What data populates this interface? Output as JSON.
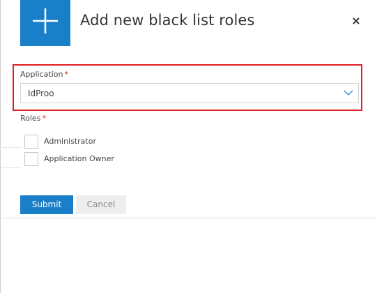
{
  "dialog": {
    "title": "Add new black list roles",
    "close_icon": "close-icon",
    "header_icon": "plus-icon",
    "accent_color": "#1a7fc9",
    "highlight_color": "#e01e24"
  },
  "form": {
    "application": {
      "label": "Application",
      "required_marker": "*",
      "selected_value": "IdProo",
      "chevron_icon": "chevron-down-icon"
    },
    "roles": {
      "label": "Roles",
      "required_marker": "*",
      "options": [
        {
          "label": "Administrator",
          "checked": false
        },
        {
          "label": "Application Owner",
          "checked": false
        }
      ]
    }
  },
  "actions": {
    "submit_label": "Submit",
    "cancel_label": "Cancel"
  }
}
